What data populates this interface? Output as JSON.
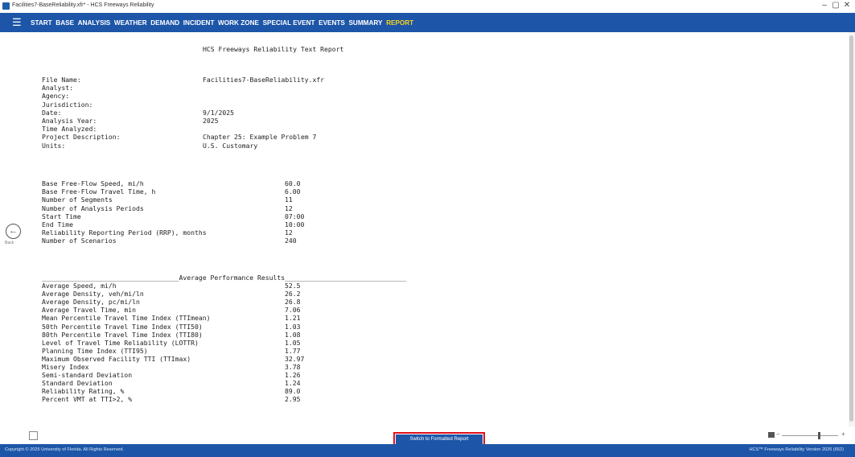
{
  "window": {
    "title": "Facilities7-BaseReliability.xfr* - HCS Freeways Reliability",
    "minimize": "–",
    "maximize": "▢",
    "close": "✕"
  },
  "menu": {
    "items": [
      {
        "label": "START"
      },
      {
        "label": "BASE"
      },
      {
        "label": "ANALYSIS"
      },
      {
        "label": "WEATHER"
      },
      {
        "label": "DEMAND"
      },
      {
        "label": "INCIDENT"
      },
      {
        "label": "WORK ZONE"
      },
      {
        "label": "SPECIAL EVENT"
      },
      {
        "label": "EVENTS"
      },
      {
        "label": "SUMMARY"
      },
      {
        "label": "REPORT"
      }
    ],
    "active": "REPORT"
  },
  "nav": {
    "back_label": "Back"
  },
  "report": {
    "title": "HCS Freeways Reliability Text Report",
    "info": [
      {
        "label": "File Name:",
        "value": "Facilities7-BaseReliability.xfr"
      },
      {
        "label": "Analyst:",
        "value": ""
      },
      {
        "label": "Agency:",
        "value": ""
      },
      {
        "label": "Jurisdiction:",
        "value": ""
      },
      {
        "label": "Date:",
        "value": "9/1/2025"
      },
      {
        "label": "Analysis Year:",
        "value": "2025"
      },
      {
        "label": "Time Analyzed:",
        "value": ""
      },
      {
        "label": "Project Description:",
        "value": "Chapter 25: Example Problem 7"
      },
      {
        "label": "Units:",
        "value": "U.S. Customary"
      }
    ],
    "params": [
      {
        "label": "Base Free-Flow Speed, mi/h",
        "value": "60.0"
      },
      {
        "label": "Base Free-Flow Travel Time, h",
        "value": "6.00"
      },
      {
        "label": "Number of Segments",
        "value": "11"
      },
      {
        "label": "Number of Analysis Periods",
        "value": "12"
      },
      {
        "label": "Start Time",
        "value": "07:00"
      },
      {
        "label": "End Time",
        "value": "10:00"
      },
      {
        "label": "Reliability Reporting Period (RRP), months",
        "value": "12"
      },
      {
        "label": "Number of Scenarios",
        "value": "240"
      }
    ],
    "results_header": "___________________________________Average Performance Results_______________________________",
    "results": [
      {
        "label": "Average Speed, mi/h",
        "value": "52.5"
      },
      {
        "label": "Average Density, veh/mi/ln",
        "value": "26.2"
      },
      {
        "label": "Average Density, pc/mi/ln",
        "value": "26.8"
      },
      {
        "label": "Average Travel Time, min",
        "value": "7.06"
      },
      {
        "label": "Mean Percentile Travel Time Index (TTImean)",
        "value": "1.21"
      },
      {
        "label": "50th Percentile Travel Time Index (TTI50)",
        "value": "1.03"
      },
      {
        "label": "80th Percentile Travel Time Index (TTI80)",
        "value": "1.08"
      },
      {
        "label": "Level of Travel Time Reliability (LOTTR)",
        "value": "1.05"
      },
      {
        "label": "Planning Time Index (TTI95)",
        "value": "1.77"
      },
      {
        "label": "Maximum Observed Facility TTI (TTImax)",
        "value": "32.97"
      },
      {
        "label": "Misery Index",
        "value": "3.78"
      },
      {
        "label": "Semi-standard Deviation",
        "value": "1.26"
      },
      {
        "label": "Standard Deviation",
        "value": "1.24"
      },
      {
        "label": "Reliability Rating, %",
        "value": "89.0"
      },
      {
        "label": "Percent VMT at TTI>2, %",
        "value": "2.95"
      }
    ]
  },
  "bottom": {
    "switch_button": "Switch to Formatted Report"
  },
  "status": {
    "left": "Copyright © 2025 University of Florida. All Rights Reserved.",
    "right": "HCS™ Freeways Reliability Version 2026 (652)"
  },
  "colors": {
    "accent": "#1d56a8",
    "active_menu": "#f6d21d",
    "highlight": "#e0101a"
  }
}
